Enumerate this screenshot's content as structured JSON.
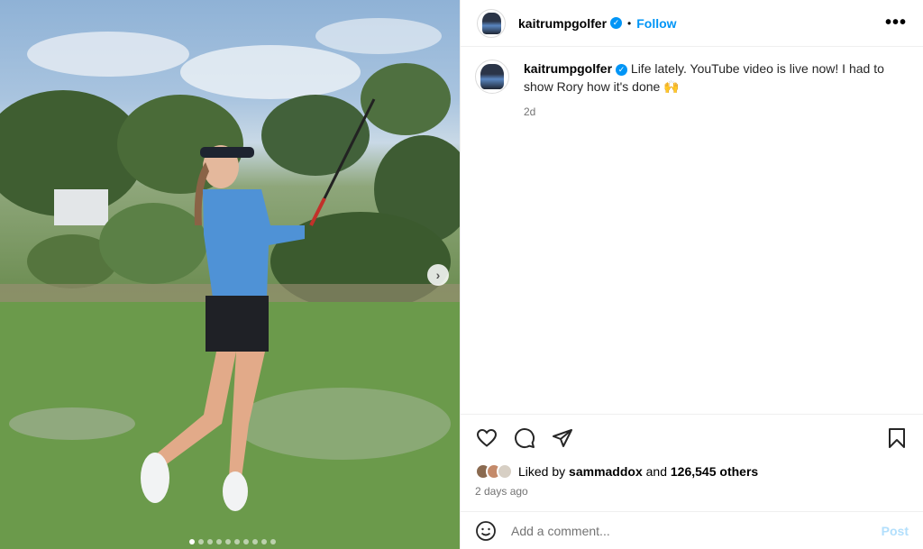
{
  "post": {
    "username": "kaitrumpgolfer",
    "follow_label": "Follow",
    "separator": "•",
    "more_label": "•••",
    "caption": "Life lately. YouTube video is live now! I had to show Rory how it's done 🙌",
    "caption_time": "2d",
    "liked_by_prefix": "Liked by",
    "liked_by_user": "sammaddox",
    "liked_by_and": "and",
    "liked_by_count": "126,545 others",
    "date": "2 days ago",
    "comment_placeholder": "Add a comment...",
    "post_label": "Post"
  },
  "media": {
    "carousel_total": 10,
    "carousel_active": 1,
    "next_arrow": "›"
  },
  "icons": {
    "like": "heart-icon",
    "comment": "comment-icon",
    "share": "share-icon",
    "save": "bookmark-icon",
    "emoji": "emoji-icon",
    "verified": "verified-badge-icon",
    "more": "more-options-icon"
  },
  "colors": {
    "accent": "#0095f6",
    "post_disabled": "#b2dffc",
    "muted": "#737373"
  }
}
